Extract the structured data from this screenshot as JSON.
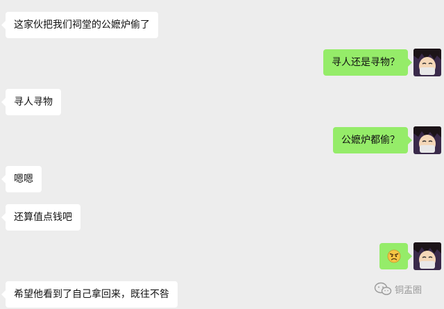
{
  "conversation": {
    "messages": [
      {
        "side": "left",
        "text": "这家伙把我们祠堂的公嬷炉偷了"
      },
      {
        "side": "right",
        "text": "寻人还是寻物？"
      },
      {
        "side": "left",
        "text": "寻人寻物"
      },
      {
        "side": "right",
        "text": "公嬷炉都偷？"
      },
      {
        "side": "left",
        "text": "嗯嗯"
      },
      {
        "side": "left",
        "text": "还算值点钱吧"
      },
      {
        "side": "right",
        "emoji": "angry-face-emoji"
      },
      {
        "side": "left",
        "text": "希望他看到了自己拿回来，既往不咎"
      }
    ]
  },
  "watermark": {
    "icon": "wechat-icon",
    "text": "铜盂圈"
  },
  "colors": {
    "background": "#ededed",
    "left_bubble": "#ffffff",
    "right_bubble": "#95ec69"
  }
}
